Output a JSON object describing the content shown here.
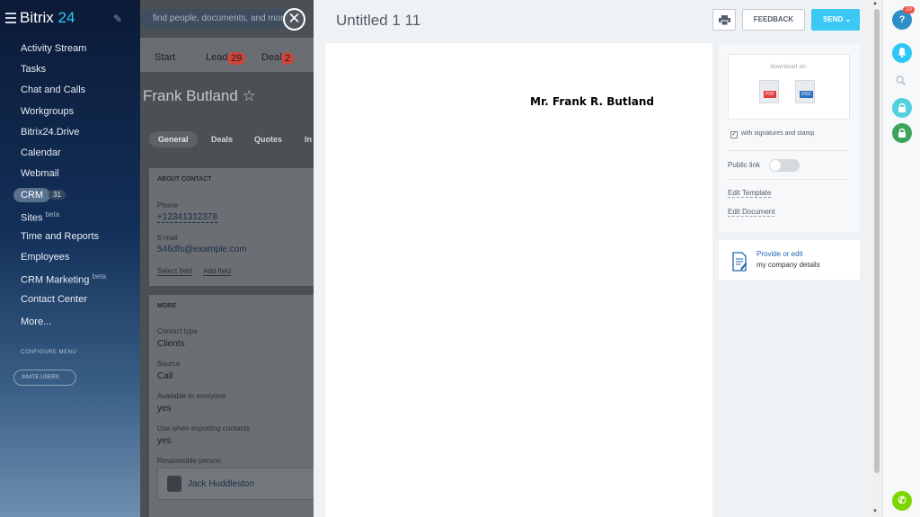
{
  "leftnav": {
    "logo_text": "Bitrix",
    "logo_num": "24",
    "items": [
      "Activity Stream",
      "Tasks",
      "Chat and Calls",
      "Workgroups",
      "Bitrix24.Drive",
      "Calendar",
      "Webmail"
    ],
    "crm_label": "CRM",
    "crm_count": "31",
    "sites_label": "Sites",
    "sites_beta": "beta",
    "items2": [
      "Time and Reports",
      "Employees"
    ],
    "crm_marketing_label": "CRM Marketing",
    "crm_marketing_beta": "beta",
    "contact_center": "Contact Center",
    "more": "More...",
    "configure_menu": "CONFIGURE MENU",
    "invite_users": "INVITE USERS"
  },
  "crm": {
    "search_placeholder": "find people, documents, and more",
    "tabs": {
      "start": "Start",
      "leads": "Leads",
      "leads_badge": "29",
      "deals": "Deals",
      "deals_badge": "2"
    },
    "contact_name": "Frank Butland",
    "subtabs": [
      "General",
      "Deals",
      "Quotes",
      "In"
    ],
    "about_title": "ABOUT CONTACT",
    "phone_label": "Phone",
    "phone_value": "+12341312378",
    "email_label": "E-mail",
    "email_value": "546dfs@example.com",
    "select_field": "Select field",
    "add_field": "Add field",
    "more_title": "MORE",
    "contact_type_label": "Contact type",
    "contact_type_value": "Clients",
    "source_label": "Source",
    "source_value": "Call",
    "available_label": "Available to everyone",
    "available_value": "yes",
    "export_label": "Use when exporting contacts",
    "export_value": "yes",
    "responsible_label": "Responsible person",
    "responsible_name": "Jack Huddleston"
  },
  "slider": {
    "title": "Untitled 1 11",
    "feedback": "FEEDBACK",
    "send": "SEND",
    "document_name": "Mr. Frank R. Butland",
    "download_as": "download as:",
    "pdf_label": "PDF",
    "doc_label": "DOC",
    "with_signatures": "with signatures and stamp",
    "public_link": "Public link",
    "edit_template": "Edit Template",
    "edit_document": "Edit Document",
    "provide_or_edit": "Provide or edit",
    "company_details": "my company details"
  },
  "rightbar": {
    "help_badge": "10"
  },
  "colors": {
    "accent": "#3bc8f5",
    "link": "#2067b0",
    "lock_blue": "#55d0e0",
    "lock_green": "#3ea35a",
    "phone_green": "#7bd500"
  }
}
